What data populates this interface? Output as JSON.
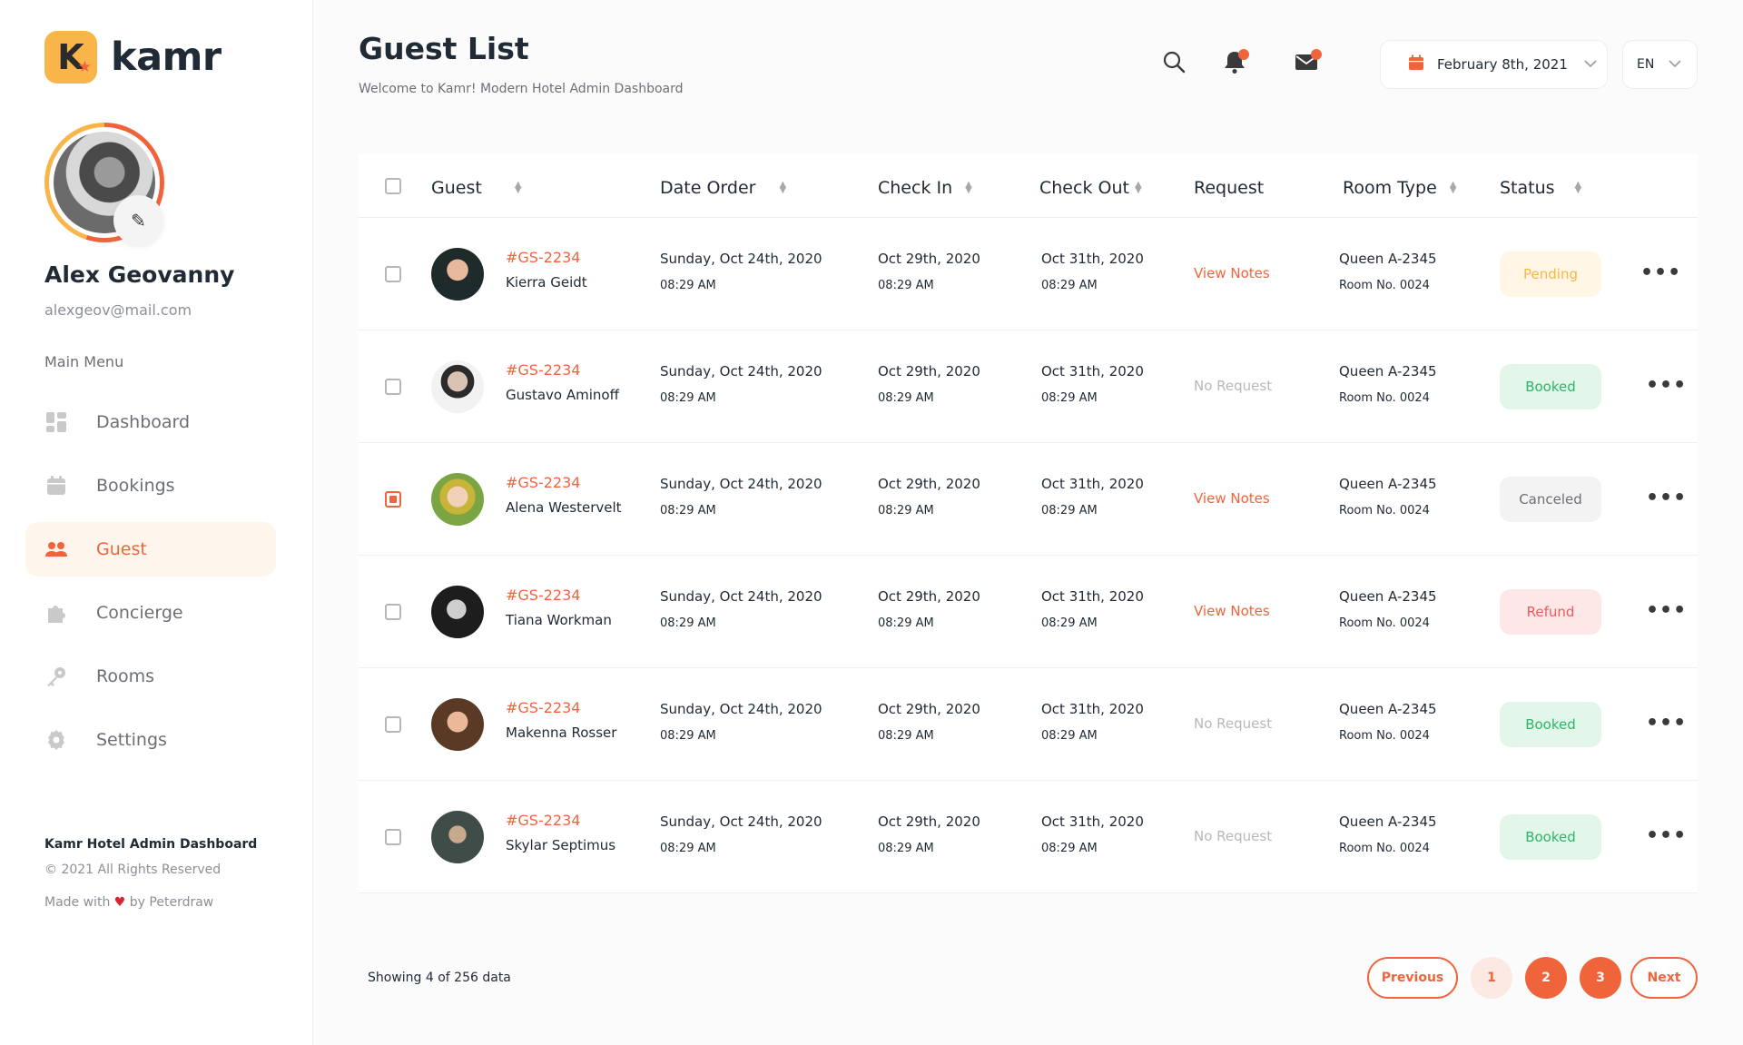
{
  "brand": {
    "name": "kamr",
    "mark": "K"
  },
  "profile": {
    "name": "Alex Geovanny",
    "email": "alexgeov@mail.com"
  },
  "menu_title": "Main Menu",
  "menu": [
    {
      "label": "Dashboard",
      "icon": "dashboard-icon",
      "active": false
    },
    {
      "label": "Bookings",
      "icon": "calendar-icon",
      "active": false
    },
    {
      "label": "Guest",
      "icon": "users-icon",
      "active": true
    },
    {
      "label": "Concierge",
      "icon": "puzzle-icon",
      "active": false
    },
    {
      "label": "Rooms",
      "icon": "key-icon",
      "active": false
    },
    {
      "label": "Settings",
      "icon": "gear-icon",
      "active": false
    }
  ],
  "footer": {
    "title": "Kamr Hotel Admin Dashboard",
    "copyright": "© 2021 All Rights Reserved",
    "made_prefix": "Made with",
    "made_suffix": "by Peterdraw"
  },
  "header": {
    "title": "Guest List",
    "subtitle": "Welcome to Kamr! Modern Hotel Admin Dashboard",
    "date": "February 8th, 2021",
    "language": "EN"
  },
  "colors": {
    "accent": "#f0643c",
    "brand_yellow": "#f9b54a"
  },
  "table": {
    "columns": [
      "Guest",
      "Date Order",
      "Check In",
      "Check Out",
      "Request",
      "Room Type",
      "Status"
    ],
    "rows": [
      {
        "id": "#GS-2234",
        "name": "Kierra Geidt",
        "order_date": "Sunday, Oct 24th, 2020",
        "order_time": "08:29 AM",
        "check_in": "Oct 29th, 2020",
        "check_in_time": "08:29 AM",
        "check_out": "Oct 31th, 2020",
        "check_out_time": "08:29 AM",
        "request": "View Notes",
        "room_type": "Queen A-2345",
        "room_no": "Room No. 0024",
        "status": "Pending",
        "checked": false
      },
      {
        "id": "#GS-2234",
        "name": "Gustavo Aminoff",
        "order_date": "Sunday, Oct 24th, 2020",
        "order_time": "08:29 AM",
        "check_in": "Oct 29th, 2020",
        "check_in_time": "08:29 AM",
        "check_out": "Oct 31th, 2020",
        "check_out_time": "08:29 AM",
        "request": "No Request",
        "room_type": "Queen A-2345",
        "room_no": "Room No. 0024",
        "status": "Booked",
        "checked": false
      },
      {
        "id": "#GS-2234",
        "name": "Alena Westervelt",
        "order_date": "Sunday, Oct 24th, 2020",
        "order_time": "08:29 AM",
        "check_in": "Oct 29th, 2020",
        "check_in_time": "08:29 AM",
        "check_out": "Oct 31th, 2020",
        "check_out_time": "08:29 AM",
        "request": "View Notes",
        "room_type": "Queen A-2345",
        "room_no": "Room No. 0024",
        "status": "Canceled",
        "checked": true
      },
      {
        "id": "#GS-2234",
        "name": "Tiana Workman",
        "order_date": "Sunday, Oct 24th, 2020",
        "order_time": "08:29 AM",
        "check_in": "Oct 29th, 2020",
        "check_in_time": "08:29 AM",
        "check_out": "Oct 31th, 2020",
        "check_out_time": "08:29 AM",
        "request": "View Notes",
        "room_type": "Queen A-2345",
        "room_no": "Room No. 0024",
        "status": "Refund",
        "checked": false
      },
      {
        "id": "#GS-2234",
        "name": "Makenna Rosser",
        "order_date": "Sunday, Oct 24th, 2020",
        "order_time": "08:29 AM",
        "check_in": "Oct 29th, 2020",
        "check_in_time": "08:29 AM",
        "check_out": "Oct 31th, 2020",
        "check_out_time": "08:29 AM",
        "request": "No Request",
        "room_type": "Queen A-2345",
        "room_no": "Room No. 0024",
        "status": "Booked",
        "checked": false
      },
      {
        "id": "#GS-2234",
        "name": "Skylar Septimus",
        "order_date": "Sunday, Oct 24th, 2020",
        "order_time": "08:29 AM",
        "check_in": "Oct 29th, 2020",
        "check_in_time": "08:29 AM",
        "check_out": "Oct 31th, 2020",
        "check_out_time": "08:29 AM",
        "request": "No Request",
        "room_type": "Queen A-2345",
        "room_no": "Room No. 0024",
        "status": "Booked",
        "checked": false
      }
    ]
  },
  "pagination": {
    "showing": "Showing 4 of 256 data",
    "previous": "Previous",
    "pages": [
      "1",
      "2",
      "3"
    ],
    "next": "Next"
  }
}
